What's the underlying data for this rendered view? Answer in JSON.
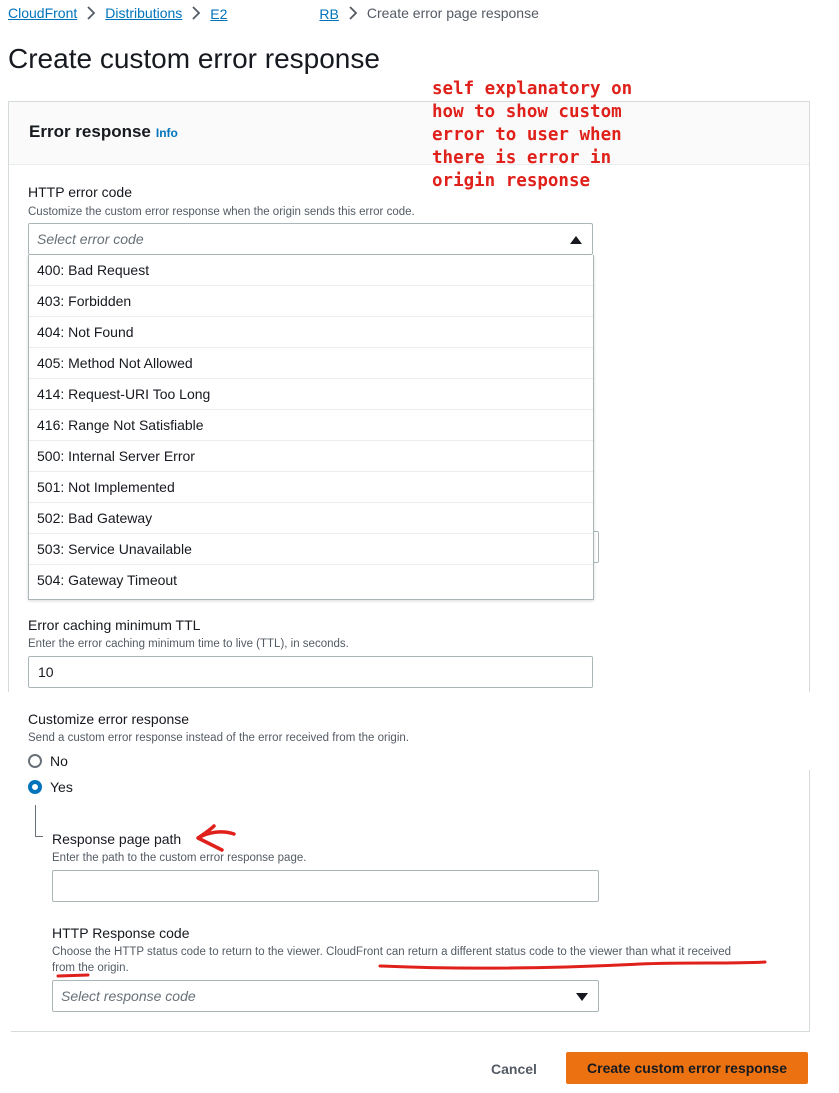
{
  "breadcrumb": {
    "items": [
      {
        "label": "CloudFront"
      },
      {
        "label": "Distributions"
      },
      {
        "label": "E2"
      },
      {
        "label": "RB"
      }
    ],
    "current": "Create error page response"
  },
  "page": {
    "title": "Create custom error response"
  },
  "annotation": {
    "text": "self explanatory on\nhow to show custom\nerror to user when\nthere is error in\norigin response",
    "color": "#e0201a"
  },
  "error_response": {
    "header": "Error response",
    "info_link": "Info",
    "http_error_code": {
      "label": "HTTP error code",
      "description": "Customize the custom error response when the origin sends this error code.",
      "placeholder": "Select error code",
      "options": [
        "400: Bad Request",
        "403: Forbidden",
        "404: Not Found",
        "405: Method Not Allowed",
        "414: Request-URI Too Long",
        "416: Range Not Satisfiable",
        "500: Internal Server Error",
        "501: Not Implemented",
        "502: Bad Gateway",
        "503: Service Unavailable",
        "504: Gateway Timeout"
      ]
    },
    "error_caching": {
      "label": "Error caching minimum TTL",
      "description": "Enter the error caching minimum time to live (TTL), in seconds.",
      "value": "10"
    },
    "customize": {
      "label": "Customize error response",
      "description": "Send a custom error response instead of the error received from the origin.",
      "options": [
        {
          "label": "No",
          "checked": false
        },
        {
          "label": "Yes",
          "checked": true
        }
      ]
    },
    "response_page_path": {
      "label": "Response page path",
      "description": "Enter the path to the custom error response page.",
      "value": ""
    },
    "http_response_code": {
      "label": "HTTP Response code",
      "description_line1": "Choose the HTTP status code to return to the viewer. CloudFront can return a different status code to the viewer than what it received",
      "description_line2": "from the origin.",
      "placeholder": "Select response code"
    }
  },
  "actions": {
    "cancel": "Cancel",
    "submit": "Create custom error response"
  },
  "colors": {
    "link": "#0073bb",
    "primary_button": "#ec7211",
    "annotation_red": "#e0201a"
  }
}
